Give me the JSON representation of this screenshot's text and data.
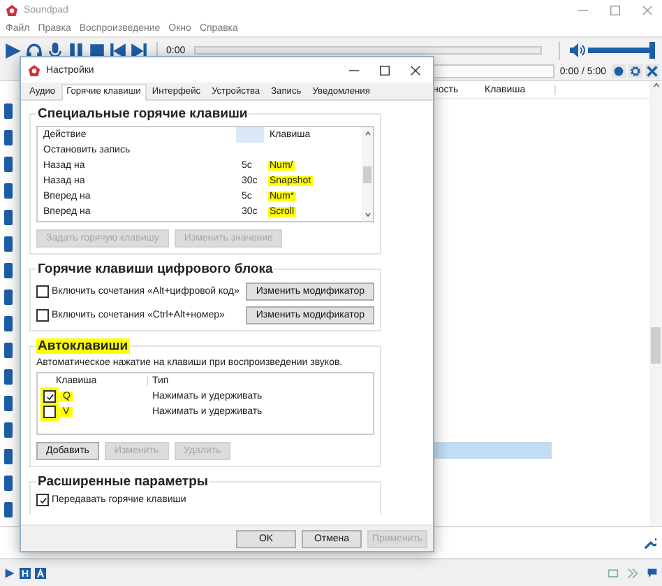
{
  "main_window": {
    "title": "Soundpad",
    "menu": [
      "Файл",
      "Правка",
      "Воспроизведение",
      "Окно",
      "Справка"
    ],
    "player": {
      "time": "0:00",
      "progress": {
        "level": 0
      },
      "volume": {
        "level": 0.95
      }
    },
    "time_readout": "0:00 / 5:00",
    "list": {
      "columns": [
        "ность",
        "Клавиша"
      ]
    }
  },
  "settings_dialog": {
    "title": "Настройки",
    "tabs": [
      {
        "label": "Аудио",
        "selected": false
      },
      {
        "label": "Горячие клавиши",
        "selected": true
      },
      {
        "label": "Интерфейс",
        "selected": false
      },
      {
        "label": "Устройства",
        "selected": false
      },
      {
        "label": "Запись",
        "selected": false
      },
      {
        "label": "Уведомления",
        "selected": false
      }
    ],
    "special_hotkeys": {
      "title": "Специальные горячие клавиши",
      "columns": [
        "Действие",
        "Клавиша"
      ],
      "rows": [
        {
          "action": "Остановить запись"
        },
        {
          "action": "Назад на",
          "value": "5с",
          "key": "Num/",
          "highlighted": true
        },
        {
          "action": "Назад на",
          "value": "30с",
          "key": "Snapshot",
          "highlighted": true
        },
        {
          "action": "Вперед на",
          "value": "5с",
          "key": "Num*",
          "highlighted": true
        },
        {
          "action": "Вперед на",
          "value": "30с",
          "key": "Scroll",
          "highlighted": true
        }
      ],
      "buttons": [
        {
          "label": "Задать горячую клавишу",
          "disabled": true
        },
        {
          "label": "Изменить значение",
          "disabled": true
        }
      ]
    },
    "numpad_hotkeys": {
      "title": "Горячие клавиши цифрового блока",
      "options": [
        {
          "label": "Включить сочетания «Alt+цифровой код»",
          "checked": false,
          "button": "Изменить модификатор"
        },
        {
          "label": "Включить сочетания «Ctrl+Alt+номер»",
          "checked": false,
          "button": "Изменить модификатор"
        }
      ]
    },
    "autokeys": {
      "title": "Автоклавиши",
      "highlighted": true,
      "description": "Автоматическое нажатие на клавиши при воспроизведении звуков.",
      "columns": [
        "Клавиша",
        "Тип"
      ],
      "rows": [
        {
          "key": "Q",
          "type": "Нажимать и удерживать",
          "checked": true,
          "highlighted": true
        },
        {
          "key": "V",
          "type": "Нажимать и удерживать",
          "checked": false,
          "highlighted": true
        }
      ],
      "buttons": [
        {
          "label": "Добавить",
          "disabled": false
        },
        {
          "label": "Изменить",
          "disabled": true
        },
        {
          "label": "Удалить",
          "disabled": true
        }
      ]
    },
    "advanced": {
      "title": "Расширенные параметры",
      "options": [
        {
          "label": "Передавать горячие клавиши",
          "checked": true
        }
      ]
    },
    "buttons": [
      {
        "label": "OK",
        "disabled": false
      },
      {
        "label": "Отмена",
        "disabled": false
      },
      {
        "label": "Применить",
        "disabled": true
      }
    ]
  }
}
